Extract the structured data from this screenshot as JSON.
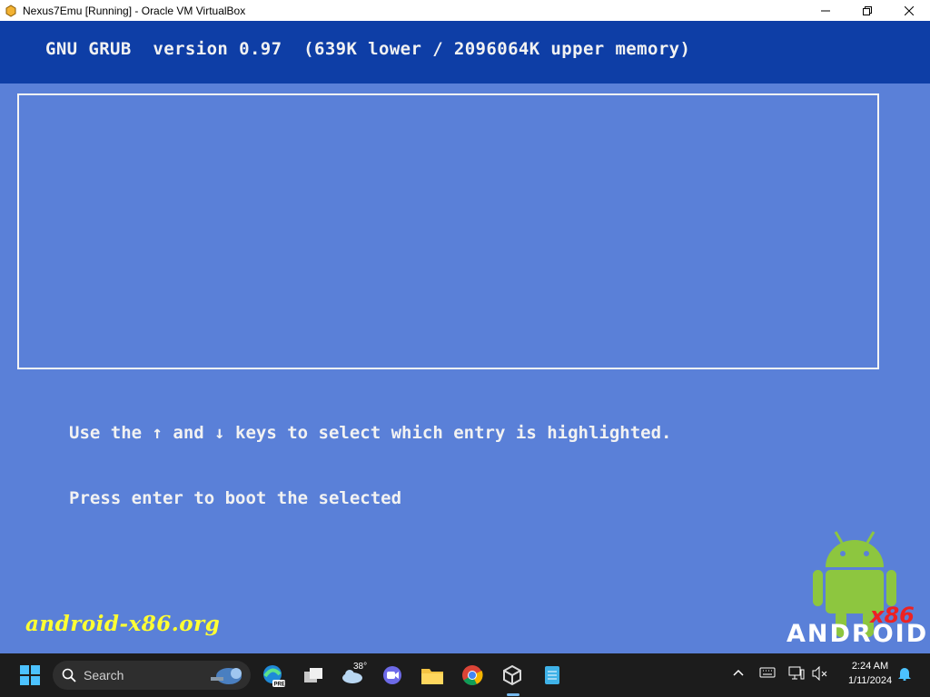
{
  "window": {
    "title": "Nexus7Emu [Running] - Oracle VM VirtualBox",
    "app_icon": "virtualbox-icon"
  },
  "grub": {
    "header": "GNU GRUB  version 0.97  (639K lower / 2096064K upper memory)",
    "instructions": [
      "Use the ↑ and ↓ keys to select which entry is highlighted.",
      "Press enter to boot the selected"
    ],
    "menu_entries": []
  },
  "branding": {
    "url": "android-x86.org",
    "android_word": "ANDROID",
    "x86": "x86",
    "logo_color": "#8dc63f"
  },
  "taskbar": {
    "search_label": "Search",
    "weather_temp": "38°",
    "time": "2:24 AM",
    "date": "1/11/2024",
    "pinned": [
      "windows-start-icon",
      "edge-beta-icon",
      "task-view-icon",
      "weather-icon",
      "teams-icon",
      "file-explorer-icon",
      "chrome-icon",
      "virtualbox-icon",
      "notepad-icon"
    ],
    "tray": [
      "chevron-up-icon",
      "keyboard-icon",
      "display-icon",
      "volume-muted-icon",
      "notification-bell-icon"
    ]
  },
  "colors": {
    "grub_background": "#5a80d8",
    "grub_header": "#0e3ea6",
    "brand_url": "#ffff33",
    "x86_red": "#ee2222"
  }
}
